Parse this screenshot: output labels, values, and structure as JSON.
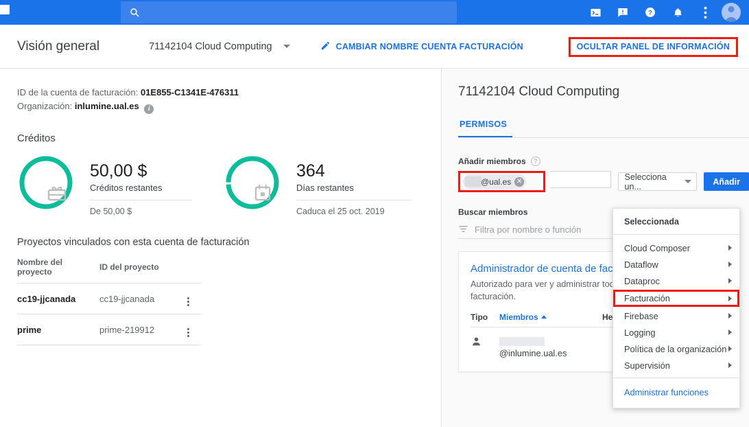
{
  "topbar": {
    "search_placeholder": "",
    "icons": [
      {
        "name": "cloud-shell-icon",
        "glyph": ">_"
      },
      {
        "name": "feedback-icon",
        "glyph": "!"
      },
      {
        "name": "help-icon",
        "glyph": "?"
      },
      {
        "name": "notifications-icon",
        "glyph": "bell"
      },
      {
        "name": "more-options-icon",
        "glyph": "⋮"
      }
    ],
    "avatar_label": "Cuenta de usuario",
    "bar_color": "#1a73e8"
  },
  "header": {
    "title": "Visión general",
    "account_name": "71142104 Cloud Computing",
    "rename_label": "CAMBIAR NOMBRE CUENTA FACTURACIÓN",
    "hide_panel_label": "OCULTAR PANEL DE INFORMACIÓN",
    "highlight_color": "#ee1c12",
    "link_color": "#1a73e8"
  },
  "left": {
    "billing_id_label": "ID de la cuenta de facturación:",
    "billing_id_value": "01E855-C1341E-476311",
    "org_label": "Organización:",
    "org_value": "inlumine.ual.es",
    "credits_title": "Créditos",
    "credits": [
      {
        "icon": "gift-card-icon",
        "value": "50,00 $",
        "label": "Créditos restantes",
        "sub": "De 50,00 $",
        "ring_color": "#0bbd9a",
        "percent": 100
      },
      {
        "icon": "calendar-icon",
        "value": "364",
        "label": "Días restantes",
        "sub": "Caduca el 25 oct. 2019",
        "ring_color": "#0bbd9a",
        "percent": 99
      }
    ],
    "projects_title": "Proyectos vinculados con esta cuenta de facturación",
    "projects_columns": [
      "Nombre del proyecto",
      "ID del proyecto",
      ""
    ],
    "projects": [
      {
        "name": "cc19-jjcanada",
        "id": "cc19-jjcanada"
      },
      {
        "name": "prime",
        "id": "prime-219912"
      }
    ]
  },
  "right": {
    "title": "71142104 Cloud Computing",
    "tabs": [
      {
        "label": "PERMISOS",
        "active": true
      }
    ],
    "add_members_label": "Añadir miembros",
    "member_chip_text": "@ual.es",
    "role_select_value": "Selecciona un...",
    "add_button_label": "Añadir",
    "search_members_label": "Buscar miembros",
    "search_members_placeholder": "Filtra por nombre o función",
    "role_card": {
      "title": "Administrador de cuenta de facturación",
      "description": "Autorizado para ver y administrar todo de facturación.",
      "columns": [
        "Tipo",
        "Miembros",
        "Heredado"
      ],
      "sort_column": "Miembros",
      "sort_direction": "asc",
      "members": [
        {
          "type_icon": "person-icon",
          "email": "@inlumine.ual.es"
        }
      ]
    }
  },
  "dropdown": {
    "group_label": "Seleccionada",
    "items": [
      {
        "label": "Cloud Composer",
        "has_submenu": true,
        "highlighted": false
      },
      {
        "label": "Dataflow",
        "has_submenu": true,
        "highlighted": false
      },
      {
        "label": "Dataproc",
        "has_submenu": true,
        "highlighted": false
      },
      {
        "label": "Facturación",
        "has_submenu": true,
        "highlighted": true
      },
      {
        "label": "Firebase",
        "has_submenu": true,
        "highlighted": false
      },
      {
        "label": "Logging",
        "has_submenu": true,
        "highlighted": false
      },
      {
        "label": "Política de la organización",
        "has_submenu": true,
        "highlighted": false
      },
      {
        "label": "Supervisión",
        "has_submenu": true,
        "highlighted": false
      }
    ],
    "footer_label": "Administrar funciones"
  }
}
